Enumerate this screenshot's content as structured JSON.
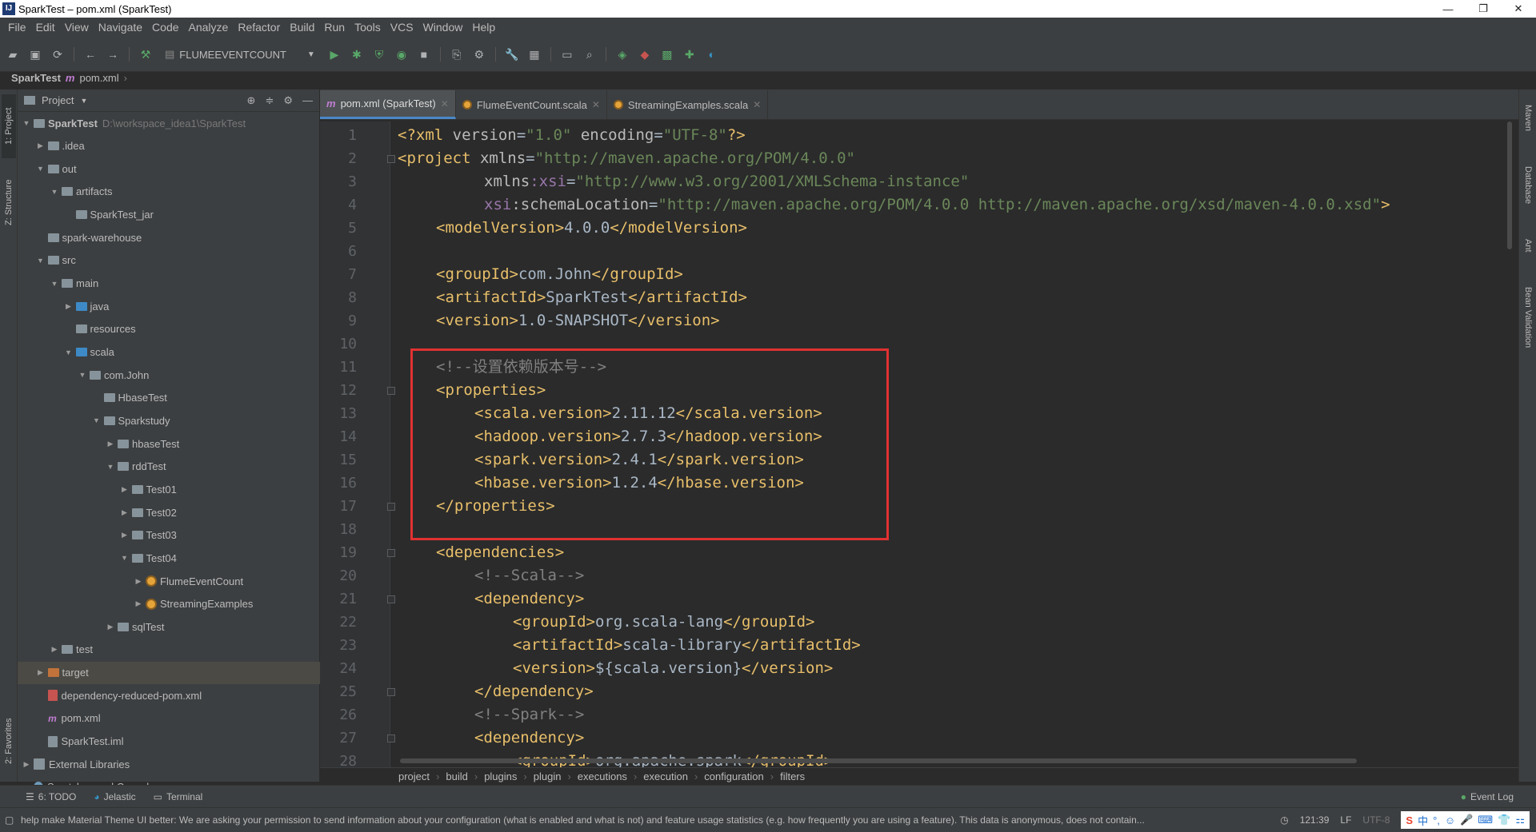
{
  "window": {
    "title": "SparkTest – pom.xml (SparkTest)"
  },
  "menu": [
    "File",
    "Edit",
    "View",
    "Navigate",
    "Code",
    "Analyze",
    "Refactor",
    "Build",
    "Run",
    "Tools",
    "VCS",
    "Window",
    "Help"
  ],
  "toolbar": {
    "run_config": "FLUMEEVENTCOUNT"
  },
  "breadcrumb": {
    "project": "SparkTest",
    "file": "pom.xml"
  },
  "left_strip": {
    "project_tab": "1: Project",
    "structure_tab": "Z: Structure",
    "favorites_tab": "2: Favorites"
  },
  "right_strip": {
    "maven": "Maven",
    "database": "Database",
    "ant": "Ant",
    "bean": "Bean Validation"
  },
  "project_panel": {
    "title": "Project",
    "tree": [
      {
        "label": "SparkTest",
        "path": "D:\\workspace_idea1\\SparkTest",
        "bold": true
      },
      {
        "label": ".idea"
      },
      {
        "label": "out"
      },
      {
        "label": "artifacts"
      },
      {
        "label": "SparkTest_jar"
      },
      {
        "label": "spark-warehouse"
      },
      {
        "label": "src"
      },
      {
        "label": "main"
      },
      {
        "label": "java"
      },
      {
        "label": "resources"
      },
      {
        "label": "scala"
      },
      {
        "label": "com.John"
      },
      {
        "label": "HbaseTest"
      },
      {
        "label": "Sparkstudy"
      },
      {
        "label": "hbaseTest"
      },
      {
        "label": "rddTest"
      },
      {
        "label": "Test01"
      },
      {
        "label": "Test02"
      },
      {
        "label": "Test03"
      },
      {
        "label": "Test04"
      },
      {
        "label": "FlumeEventCount"
      },
      {
        "label": "StreamingExamples"
      },
      {
        "label": "sqlTest"
      },
      {
        "label": "test"
      },
      {
        "label": "target"
      },
      {
        "label": "dependency-reduced-pom.xml"
      },
      {
        "label": "pom.xml"
      },
      {
        "label": "SparkTest.iml"
      },
      {
        "label": "External Libraries"
      },
      {
        "label": "Scratches and Consoles"
      }
    ]
  },
  "tabs": [
    {
      "label": "pom.xml (SparkTest)"
    },
    {
      "label": "FlumeEventCount.scala"
    },
    {
      "label": "StreamingExamples.scala"
    }
  ],
  "code": {
    "line_numbers": [
      "1",
      "2",
      "3",
      "4",
      "5",
      "6",
      "7",
      "8",
      "9",
      "10",
      "11",
      "12",
      "13",
      "14",
      "15",
      "16",
      "17",
      "18",
      "19",
      "20",
      "21",
      "22",
      "23",
      "24",
      "25",
      "26",
      "27",
      "28"
    ],
    "l1": {
      "a": "<?xml ",
      "b": "version",
      "c": "=",
      "d": "\"1.0\"",
      "e": " encoding",
      "f": "=",
      "g": "\"UTF-8\"",
      "h": "?>"
    },
    "l2": {
      "a": "<project ",
      "b": "xmlns",
      "c": "=",
      "d": "\"http://maven.apache.org/POM/4.0.0\""
    },
    "l3": {
      "a": "xmlns",
      "b": ":xsi",
      "c": "=",
      "d": "\"http://www.w3.org/2001/XMLSchema-instance\""
    },
    "l4": {
      "a": "xsi",
      "b": ":schemaLocation",
      "c": "=",
      "d": "\"http://maven.apache.org/POM/4.0.0 http://maven.apache.org/xsd/maven-4.0.0.xsd\"",
      "e": ">"
    },
    "l5": {
      "a": "<modelVersion>",
      "b": "4.0.0",
      "c": "</modelVersion>"
    },
    "l7": {
      "a": "<groupId>",
      "b": "com.John",
      "c": "</groupId>"
    },
    "l8": {
      "a": "<artifactId>",
      "b": "SparkTest",
      "c": "</artifactId>"
    },
    "l9": {
      "a": "<version>",
      "b": "1.0-SNAPSHOT",
      "c": "</version>"
    },
    "l11": "<!--设置依赖版本号-->",
    "l12": "<properties>",
    "l13": {
      "a": "<scala.version>",
      "b": "2.11.12",
      "c": "</scala.version>"
    },
    "l14": {
      "a": "<hadoop.version>",
      "b": "2.7.3",
      "c": "</hadoop.version>"
    },
    "l15": {
      "a": "<spark.version>",
      "b": "2.4.1",
      "c": "</spark.version>"
    },
    "l16": {
      "a": "<hbase.version>",
      "b": "1.2.4",
      "c": "</hbase.version>"
    },
    "l17": "</properties>",
    "l19": "<dependencies>",
    "l20": "<!--Scala-->",
    "l21": "<dependency>",
    "l22": {
      "a": "<groupId>",
      "b": "org.scala-lang",
      "c": "</groupId>"
    },
    "l23": {
      "a": "<artifactId>",
      "b": "scala-library",
      "c": "</artifactId>"
    },
    "l24": {
      "a": "<version>",
      "b": "${scala.version}",
      "c": "</version>"
    },
    "l25": "</dependency>",
    "l26": "<!--Spark-->",
    "l27": "<dependency>",
    "l28": {
      "a": "<groupId>",
      "b": "org.apache.spark",
      "c": "</groupId>"
    }
  },
  "code_breadcrumb": [
    "project",
    "build",
    "plugins",
    "plugin",
    "executions",
    "execution",
    "configuration",
    "filters"
  ],
  "bottom_tools": {
    "todo": "6: TODO",
    "jelastic": "Jelastic",
    "terminal": "Terminal",
    "event_log": "Event Log"
  },
  "status": {
    "message": "help make Material Theme UI better: We are asking your permission to send information about your configuration (what is enabled and what is not) and feature usage statistics (e.g. how frequently you are using a feature). This data is anonymous, does not contain...",
    "position": "121:39",
    "line_sep": "LF",
    "encoding": "UTF-8",
    "ime_logo": "S",
    "ime_lang": "中"
  },
  "colors": {
    "tag": "#e8bf6a",
    "string": "#6a8759",
    "comment": "#808080",
    "highlight_box": "#e03131"
  }
}
